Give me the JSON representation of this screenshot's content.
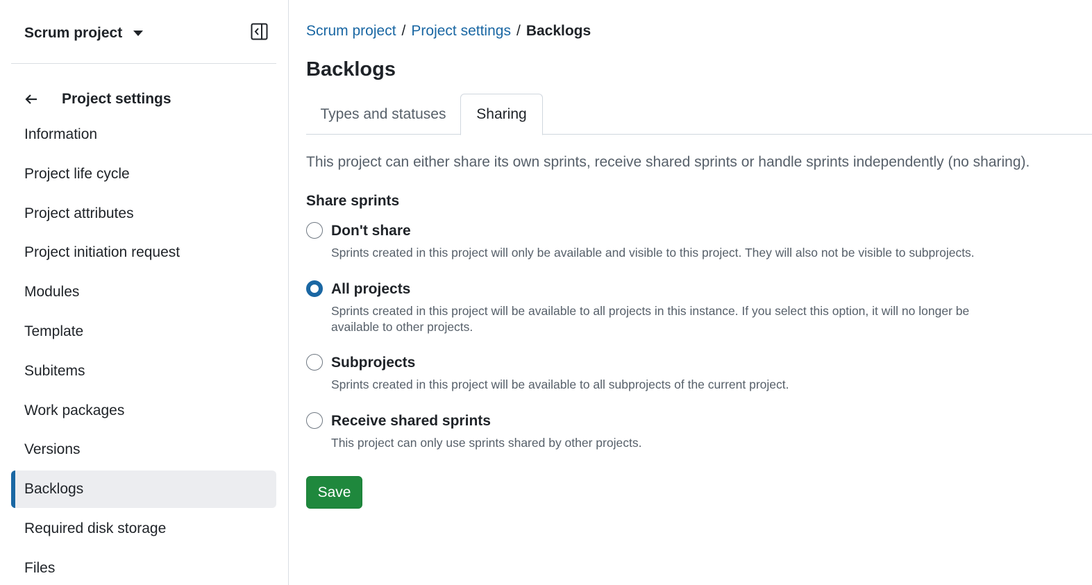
{
  "sidebar": {
    "project_name": "Scrum project",
    "back_title": "Project settings",
    "items": [
      {
        "label": "Information"
      },
      {
        "label": "Project life cycle"
      },
      {
        "label": "Project attributes"
      },
      {
        "label": "Project initiation request"
      },
      {
        "label": "Modules"
      },
      {
        "label": "Template"
      },
      {
        "label": "Subitems"
      },
      {
        "label": "Work packages"
      },
      {
        "label": "Versions"
      },
      {
        "label": "Backlogs",
        "active": true
      },
      {
        "label": "Required disk storage"
      },
      {
        "label": "Files"
      }
    ]
  },
  "breadcrumb": {
    "items": [
      "Scrum project",
      "Project settings"
    ],
    "separator": "/",
    "current": "Backlogs"
  },
  "page": {
    "title": "Backlogs",
    "tabs": [
      {
        "label": "Types and statuses",
        "active": false
      },
      {
        "label": "Sharing",
        "active": true
      }
    ],
    "description": "This project can either share its own sprints, receive shared sprints or handle sprints independently (no sharing).",
    "section_label": "Share sprints",
    "options": [
      {
        "label": "Don't share",
        "description": "Sprints created in this project will only be available and visible to this project. They will also not be visible to subprojects.",
        "selected": false
      },
      {
        "label": "All projects",
        "description": "Sprints created in this project will be available to all projects in this instance. If you select this option, it will no longer be available to other projects.",
        "selected": true
      },
      {
        "label": "Subprojects",
        "description": "Sprints created in this project will be available to all subprojects of the current project.",
        "selected": false
      },
      {
        "label": "Receive shared sprints",
        "description": "This project can only use sprints shared by other projects.",
        "selected": false
      }
    ],
    "save_label": "Save"
  },
  "colors": {
    "accent": "#1a67a3",
    "save_button": "#1f883d",
    "active_item_bg": "#ecedf0",
    "text": "#1f2328",
    "muted_text": "#57606a"
  },
  "icons": {
    "project_dropdown": "caret-down-icon",
    "collapse_sidebar": "sidebar-collapse-icon",
    "back": "arrow-left-icon"
  }
}
